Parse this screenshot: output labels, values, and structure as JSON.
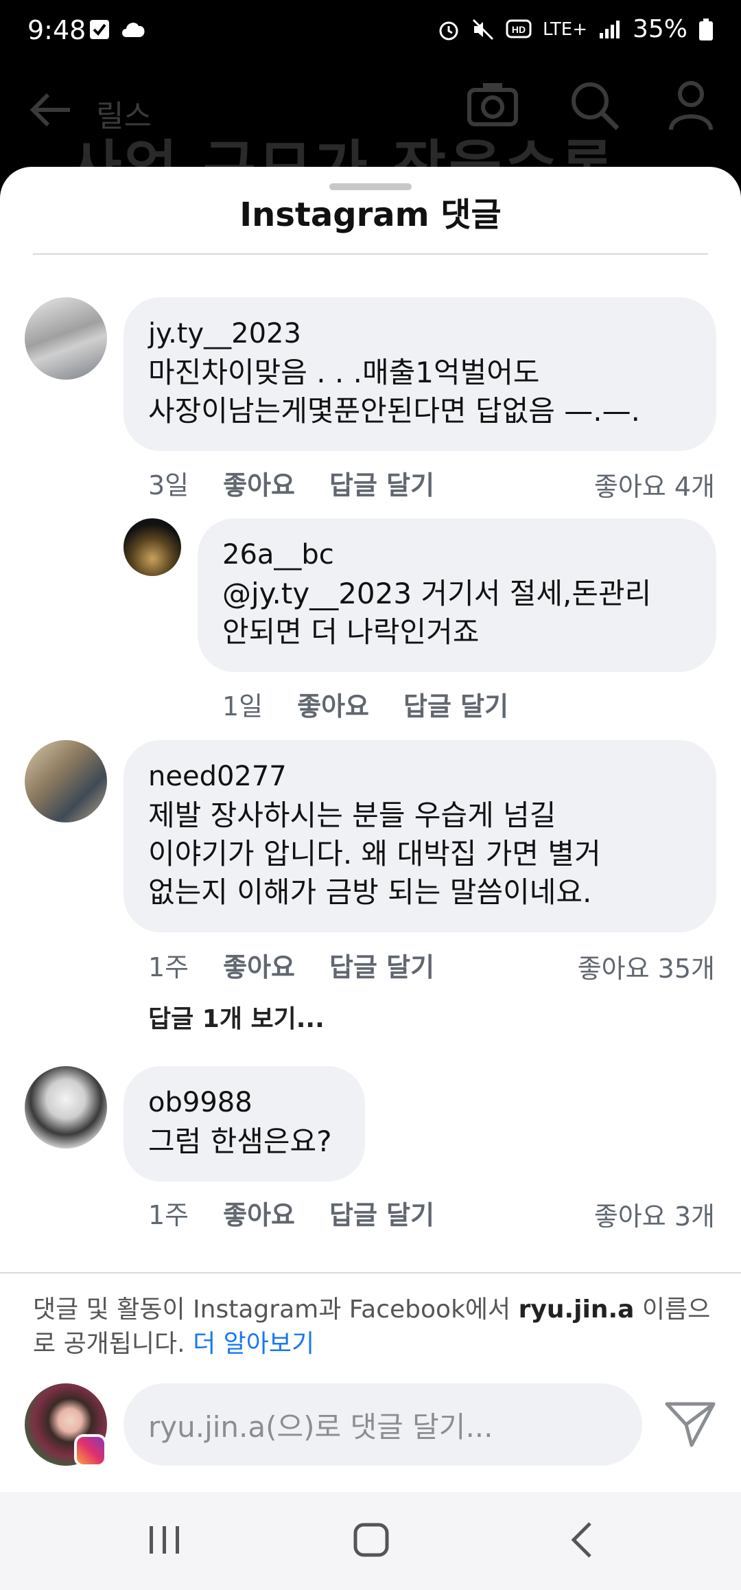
{
  "status_bar": {
    "time": "9:48",
    "battery": "35%",
    "network": "LTE+"
  },
  "background_app": {
    "title": "릴스",
    "caption": "사업 규모가 작을수록"
  },
  "sheet": {
    "title": "Instagram 댓글"
  },
  "comments": [
    {
      "username": "jy.ty__2023",
      "text": "마진차이맞음 . . .매출1억벌어도\n사장이남는게몇푼안된다면 답없음 —.—.",
      "time": "3일",
      "like_label": "좋아요",
      "reply_label": "답글 달기",
      "likes": "좋아요 4개"
    },
    {
      "username": "26a__bc",
      "text": "@jy.ty__2023 거기서 절세,돈관리\n안되면 더 나락인거죠",
      "time": "1일",
      "like_label": "좋아요",
      "reply_label": "답글 달기"
    },
    {
      "username": "need0277",
      "text": "제발 장사하시는 분들 우습게 넘길\n이야기가 압니다. 왜 대박집 가면 별거\n없는지 이해가 금방 되는 말씀이네요.",
      "time": "1주",
      "like_label": "좋아요",
      "reply_label": "답글 달기",
      "likes": "좋아요 35개",
      "view_replies": "답글 1개 보기..."
    },
    {
      "username": "ob9988",
      "text": "그럼 한샘은요?",
      "time": "1주",
      "like_label": "좋아요",
      "reply_label": "답글 달기",
      "likes": "좋아요 3개"
    }
  ],
  "notice": {
    "prefix": "댓글 및 활동이 Instagram과 Facebook에서 ",
    "username": "ryu.jin.a",
    "suffix": " 이름으로 공개됩니다. ",
    "link": "더 알아보기"
  },
  "composer": {
    "placeholder": "ryu.jin.a(으)로 댓글 달기..."
  },
  "colors": {
    "bubble": "#f0f1f5",
    "link": "#1877f2",
    "meta": "#606770"
  }
}
